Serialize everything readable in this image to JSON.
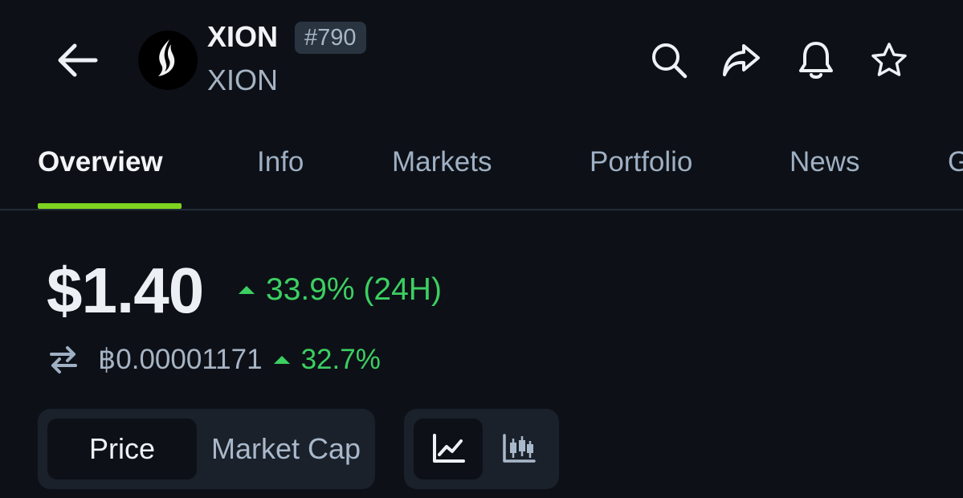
{
  "header": {
    "back_icon": "arrow-left-icon",
    "coin_name": "XION",
    "rank": "#790",
    "coin_symbol": "XION",
    "logo_icon": "xion-flame-logo",
    "actions": [
      "search-icon",
      "share-icon",
      "bell-icon",
      "star-icon"
    ]
  },
  "tabs": [
    {
      "label": "Overview",
      "active": true
    },
    {
      "label": "Info"
    },
    {
      "label": "Markets"
    },
    {
      "label": "Portfolio"
    },
    {
      "label": "News"
    },
    {
      "label": "G"
    }
  ],
  "price": {
    "usd": "$1.40",
    "change_24h": "33.9% (24H)",
    "btc_value": "฿0.00001171",
    "btc_change": "32.7%"
  },
  "chart_controls": {
    "metric_options": [
      "Price",
      "Market Cap"
    ],
    "selected_metric": "Price",
    "chart_types": [
      "line-chart-icon",
      "candlestick-chart-icon"
    ],
    "selected_chart_type": "line-chart-icon"
  },
  "colors": {
    "background": "#0d1117",
    "accent_green": "#7ed321",
    "positive": "#3ccf62",
    "muted_text": "#9fb0c4",
    "control_bg": "#1a212b"
  }
}
